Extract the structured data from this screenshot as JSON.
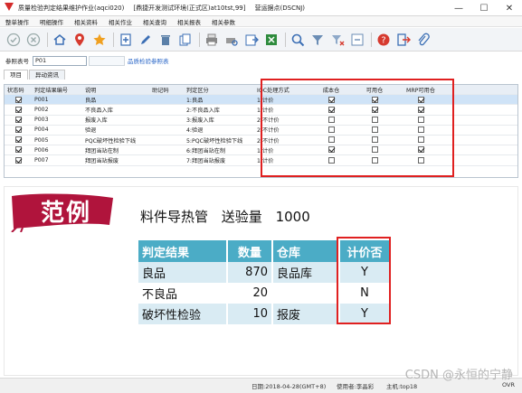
{
  "window": {
    "title_parts": [
      "质量检验判定结果维护作业(aqci020)",
      "[鼎捷开发测试环境(正式区)at10tst,99]",
      "营运据点(DSCNJ)"
    ],
    "minimize": "—",
    "maximize": "☐",
    "close": "✕"
  },
  "menu": [
    "整单操作",
    "明细操作",
    "相关资料",
    "相关作业",
    "相关查询",
    "相关报表",
    "相关参数"
  ],
  "toolbar_icons": [
    "check-icon",
    "cancel-icon",
    "home-icon",
    "pin-icon",
    "star-icon",
    "new-doc-icon",
    "edit-icon",
    "delete-icon",
    "copy-icon",
    "print-icon",
    "print-preview-icon",
    "export-icon",
    "excel-icon",
    "query-icon",
    "filter-icon",
    "filter-clear-icon",
    "refresh-icon",
    "help-icon",
    "exit-icon",
    "attach-icon"
  ],
  "ref": {
    "label": "参照表号",
    "value": "P01",
    "link": "品质检验参照表"
  },
  "tabs": [
    "项目",
    "异动资讯"
  ],
  "grid": {
    "headers": [
      "状态码",
      "判定结果编号",
      "说明",
      "助记码",
      "判定区分",
      "IQC处理方式",
      "成本仓",
      "可用仓",
      "MRP可用仓"
    ],
    "rows": [
      {
        "code": "P001",
        "desc": "良品",
        "mnemonic": "",
        "div": "1:良品",
        "iqc": "1:计价",
        "cost": true,
        "avail": true,
        "mrp": true
      },
      {
        "code": "P002",
        "desc": "不良品入库",
        "mnemonic": "",
        "div": "2:不良品入库",
        "iqc": "1:计价",
        "cost": true,
        "avail": true,
        "mrp": true
      },
      {
        "code": "P003",
        "desc": "报废入库",
        "mnemonic": "",
        "div": "3:报废入库",
        "iqc": "2:不计价",
        "cost": false,
        "avail": false,
        "mrp": false
      },
      {
        "code": "P004",
        "desc": "验退",
        "mnemonic": "",
        "div": "4:验退",
        "iqc": "2:不计价",
        "cost": false,
        "avail": false,
        "mrp": false
      },
      {
        "code": "P005",
        "desc": "PQC破坏性检验下线",
        "mnemonic": "",
        "div": "5:PQC破坏性检验下线",
        "iqc": "2:不计价",
        "cost": false,
        "avail": false,
        "mrp": false
      },
      {
        "code": "P006",
        "desc": "拜团当站在制",
        "mnemonic": "",
        "div": "6:拜团当站在制",
        "iqc": "1:计价",
        "cost": true,
        "avail": false,
        "mrp": true
      },
      {
        "code": "P007",
        "desc": "拜团当站报废",
        "mnemonic": "",
        "div": "7:拜团当站报废",
        "iqc": "1:计价",
        "cost": false,
        "avail": false,
        "mrp": false
      }
    ]
  },
  "example": {
    "banner": "范例",
    "subject": [
      "料件导热管",
      "送验量",
      "1000"
    ],
    "headers": [
      "判定结果",
      "数量",
      "仓库",
      "计价否"
    ],
    "rows": [
      {
        "result": "良品",
        "qty": "870",
        "wh": "良品库",
        "price": "Y"
      },
      {
        "result": "不良品",
        "qty": "20",
        "wh": "",
        "price": "N"
      },
      {
        "result": "破坏性检验",
        "qty": "10",
        "wh": "报废",
        "price": "Y"
      }
    ]
  },
  "status": {
    "date": "日期:2018-04-28(GMT+8)",
    "user": "使用者:李晶彩",
    "host": "主机:top18",
    "mode": "OVR"
  },
  "watermark": "CSDN @永恒的宁静",
  "colors": {
    "accent_red": "#e02020",
    "table_header": "#4bacc6",
    "banner": "#b0143c"
  }
}
